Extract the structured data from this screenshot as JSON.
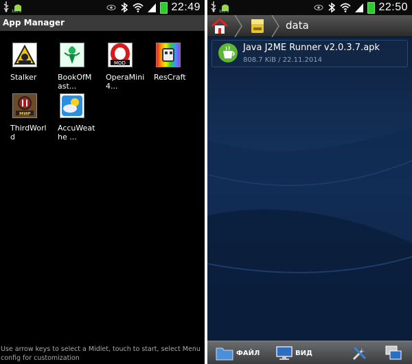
{
  "left_screen": {
    "status": {
      "time": "22:49",
      "battery_percent": "100%"
    },
    "title": "App Manager",
    "apps": [
      {
        "label": "Stalker",
        "icon": "stalker-icon"
      },
      {
        "label": "BookOfM\nast...",
        "icon": "book-of-masters-icon"
      },
      {
        "label": "OperaMini\n4...",
        "icon": "opera-mini-icon"
      },
      {
        "label": "ResCraft",
        "icon": "rescraft-icon"
      },
      {
        "label": "ThirdWorl\nd",
        "icon": "third-world-icon"
      },
      {
        "label": "AccuWeat\nhe ...",
        "icon": "accuweather-icon"
      }
    ],
    "hint": "Use arrow keys to select a Midlet, touch to start, select Menu config for customization"
  },
  "right_screen": {
    "status": {
      "time": "22:50",
      "battery_percent": "100%"
    },
    "path": {
      "home_icon": "home-icon",
      "sd_icon": "sd-card-icon",
      "current": "data"
    },
    "files": [
      {
        "name": "Java J2ME Runner v2.0.3.7.apk",
        "meta": "808.7 KiB / 22.11.2014",
        "icon": "apk-cup-icon"
      }
    ],
    "toolbar": {
      "file_label": "ФАЙЛ",
      "view_label": "ВИД",
      "tools_icon": "tools-icon",
      "windows_icon": "windows-icon"
    }
  },
  "colors": {
    "left_bg": "#000000",
    "title_bar": "#3a3a3a",
    "right_bg": "#0a1424",
    "toolbar": "#55585b"
  }
}
